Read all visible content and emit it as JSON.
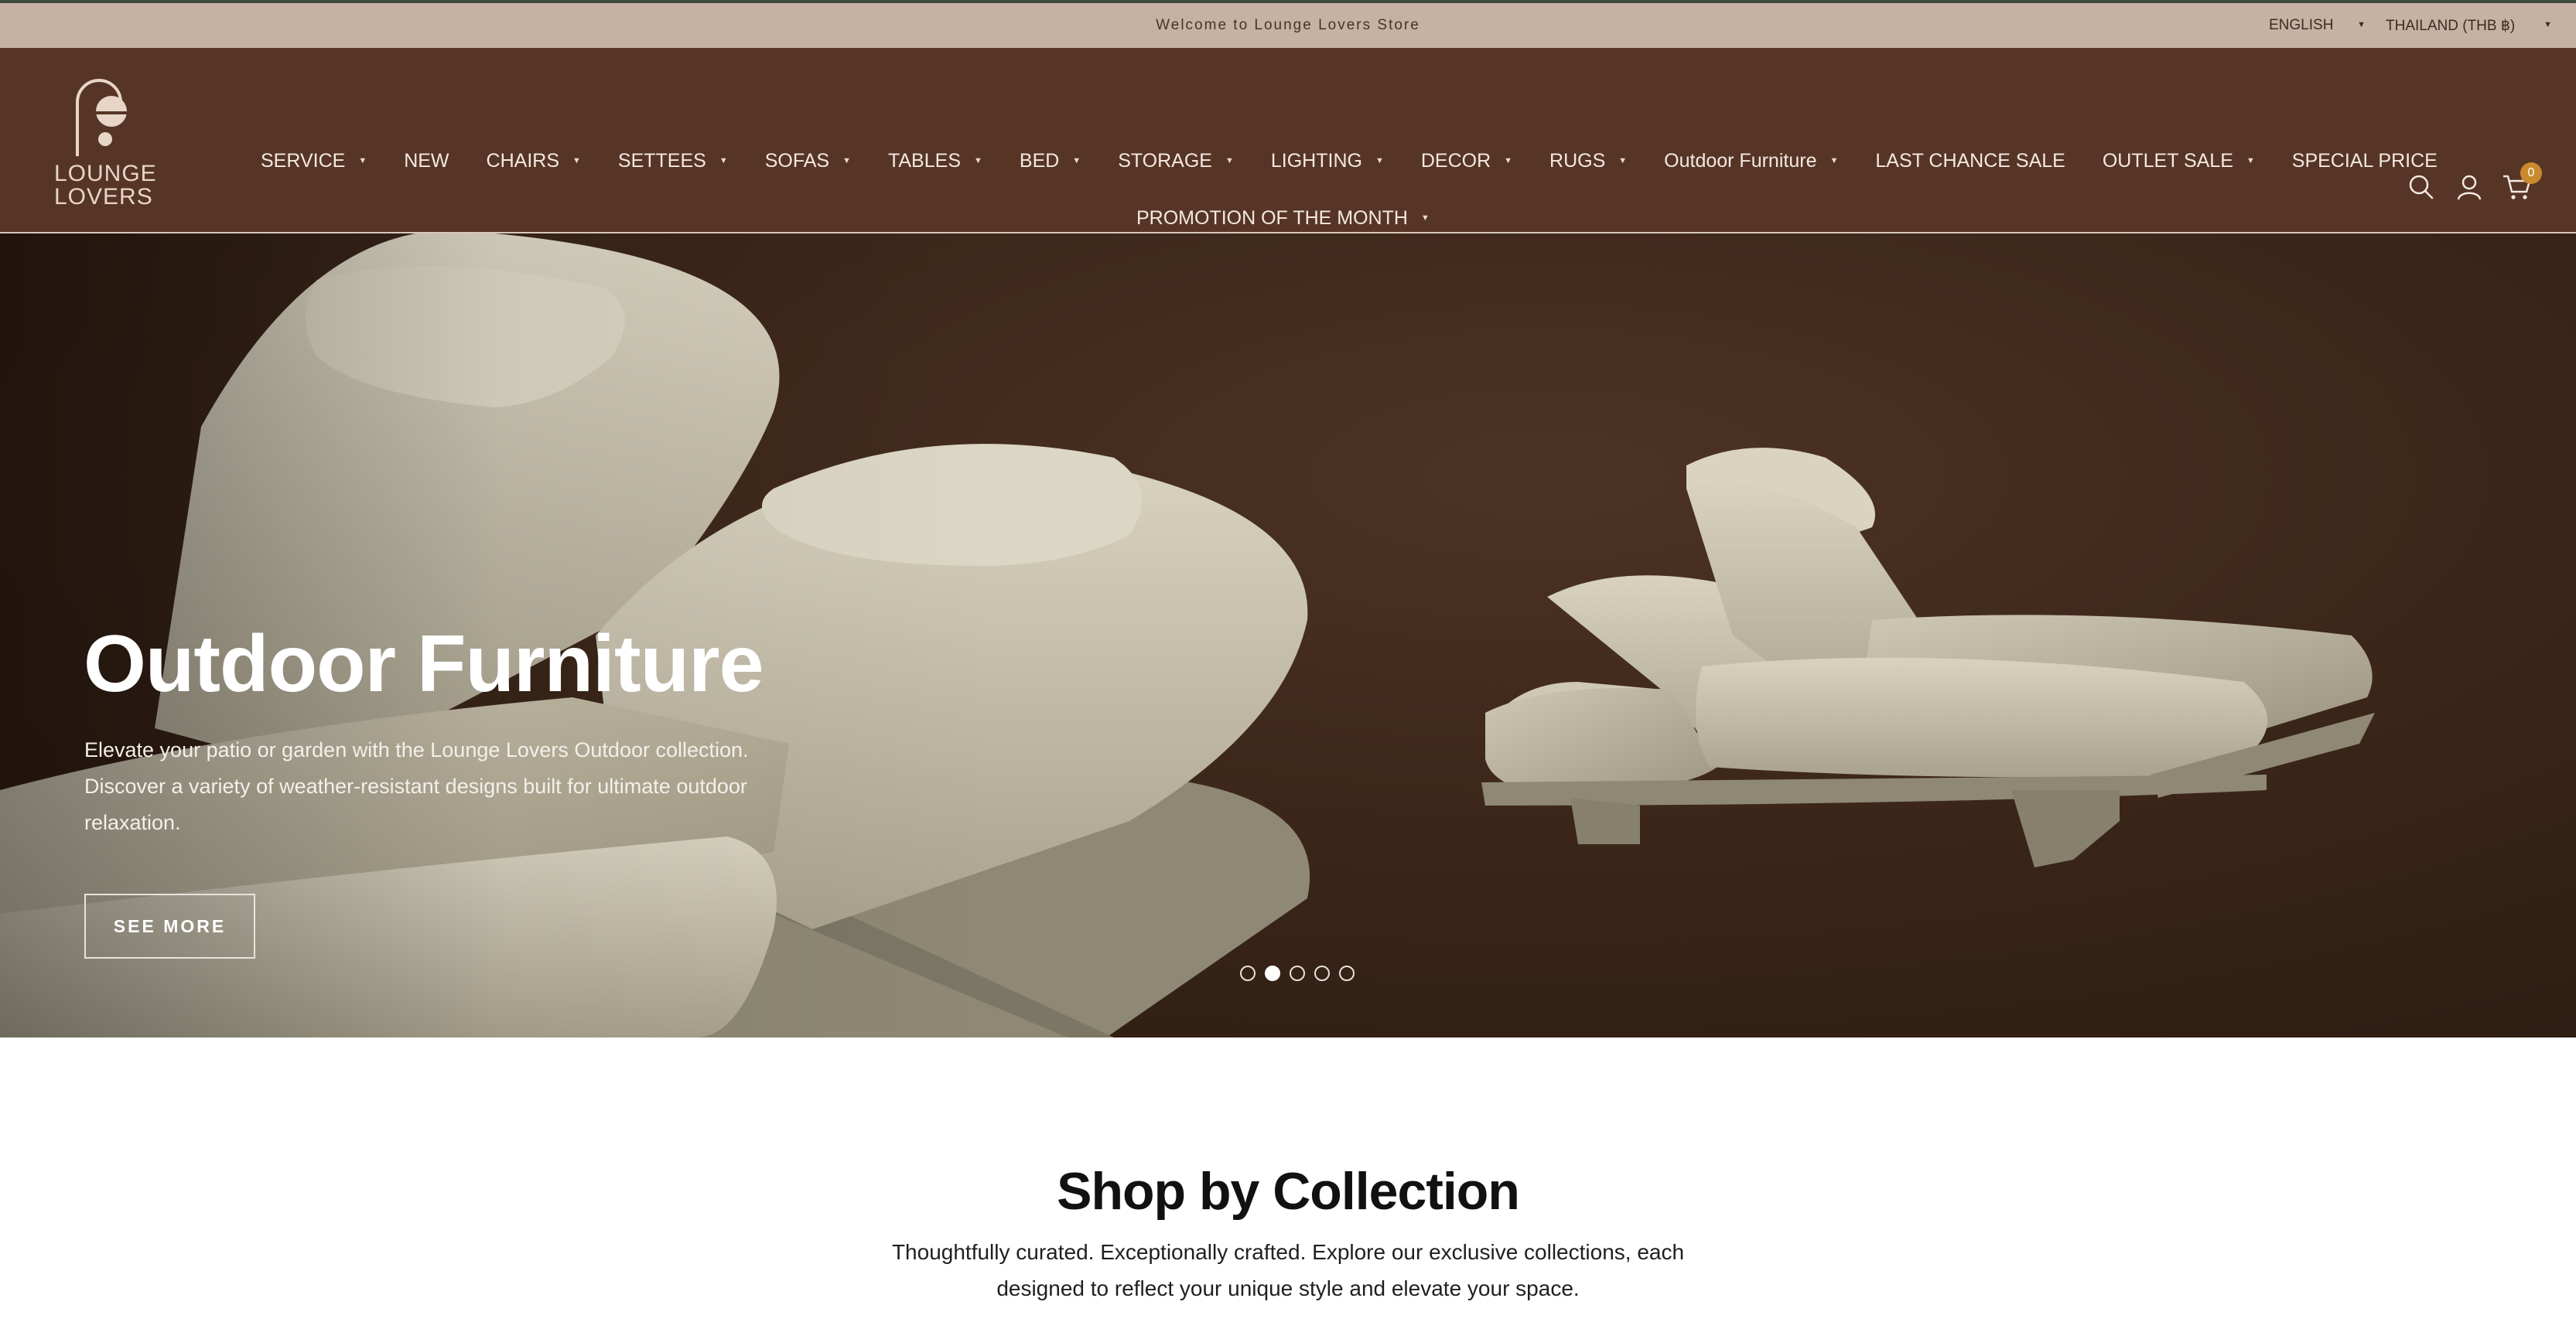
{
  "announcement": {
    "message": "Welcome to Lounge Lovers Store",
    "language": "ENGLISH",
    "country": "THAILAND (THB ฿)"
  },
  "brand": {
    "name_line1": "LOUNGE",
    "name_line2": "LOVERS"
  },
  "nav": {
    "row1": [
      {
        "label": "SERVICE",
        "has_dropdown": true
      },
      {
        "label": "NEW",
        "has_dropdown": false
      },
      {
        "label": "CHAIRS",
        "has_dropdown": true
      },
      {
        "label": "SETTEES",
        "has_dropdown": true
      },
      {
        "label": "SOFAS",
        "has_dropdown": true
      },
      {
        "label": "TABLES",
        "has_dropdown": true
      },
      {
        "label": "BED",
        "has_dropdown": true
      },
      {
        "label": "STORAGE",
        "has_dropdown": true
      },
      {
        "label": "LIGHTING",
        "has_dropdown": true
      },
      {
        "label": "DECOR",
        "has_dropdown": true
      },
      {
        "label": "RUGS",
        "has_dropdown": true
      },
      {
        "label": "Outdoor Furniture",
        "has_dropdown": true
      },
      {
        "label": "LAST CHANCE SALE",
        "has_dropdown": false
      },
      {
        "label": "OUTLET SALE",
        "has_dropdown": true
      },
      {
        "label": "SPECIAL PRICE",
        "has_dropdown": false
      }
    ],
    "row2": [
      {
        "label": "PROMOTION OF THE MONTH",
        "has_dropdown": true
      }
    ]
  },
  "header_icons": [
    "search-icon",
    "account-icon",
    "cart-icon"
  ],
  "cart": {
    "count": "0"
  },
  "hero": {
    "title": "Outdoor Furniture",
    "description": "Elevate your patio or garden with the Lounge Lovers Outdoor collection. Discover a variety of weather-resistant designs built for ultimate outdoor relaxation.",
    "button_label": "SEE MORE",
    "slides_total": 5,
    "active_slide": 2
  },
  "collections": {
    "title": "Shop by Collection",
    "subtitle": "Thoughtfully curated. Exceptionally crafted. Explore our exclusive collections, each designed to reflect your unique style and elevate your space."
  },
  "colors": {
    "announcement_bg": "#c6b1a3",
    "header_bg": "#573526",
    "cart_badge": "#c98a2c",
    "hero_bg": "#3b2619"
  }
}
